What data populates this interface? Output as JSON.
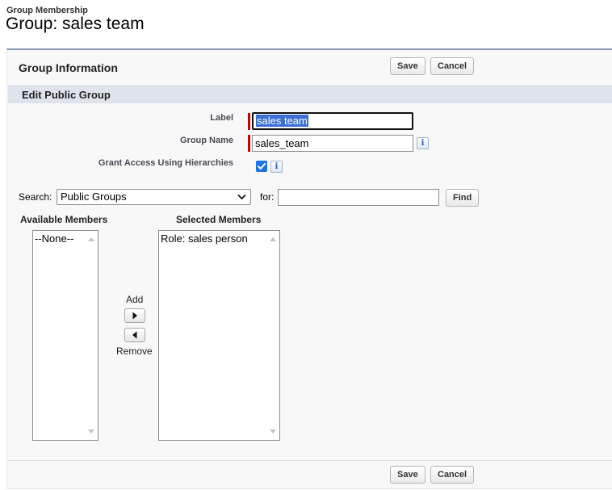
{
  "header": {
    "breadcrumb": "Group Membership",
    "title": "Group: sales team"
  },
  "panel": {
    "title": "Group Information",
    "save_label": "Save",
    "cancel_label": "Cancel"
  },
  "section": {
    "title": "Edit Public Group"
  },
  "fields": {
    "label_label": "Label",
    "label_value": "sales team",
    "group_name_label": "Group Name",
    "group_name_value": "sales_team",
    "grant_access_label": "Grant Access Using Hierarchies",
    "grant_access_checked": true
  },
  "search": {
    "label": "Search:",
    "selected_option": "Public Groups",
    "for_label": "for:",
    "for_value": "",
    "find_label": "Find"
  },
  "members": {
    "available_label": "Available Members",
    "available_items": [
      "--None--"
    ],
    "selected_label": "Selected Members",
    "selected_items": [
      "Role: sales person"
    ],
    "add_label": "Add",
    "remove_label": "Remove"
  },
  "icons": {
    "info": "info-icon",
    "check": "checkmark-icon",
    "add_arrow": "arrow-right-icon",
    "remove_arrow": "arrow-left-icon",
    "dropdown": "chevron-down-icon"
  },
  "colors": {
    "required": "#cc0000",
    "section_bar": "#dfe4ec",
    "checkbox": "#1a73e8",
    "text_selection": "#3b6fd3"
  }
}
